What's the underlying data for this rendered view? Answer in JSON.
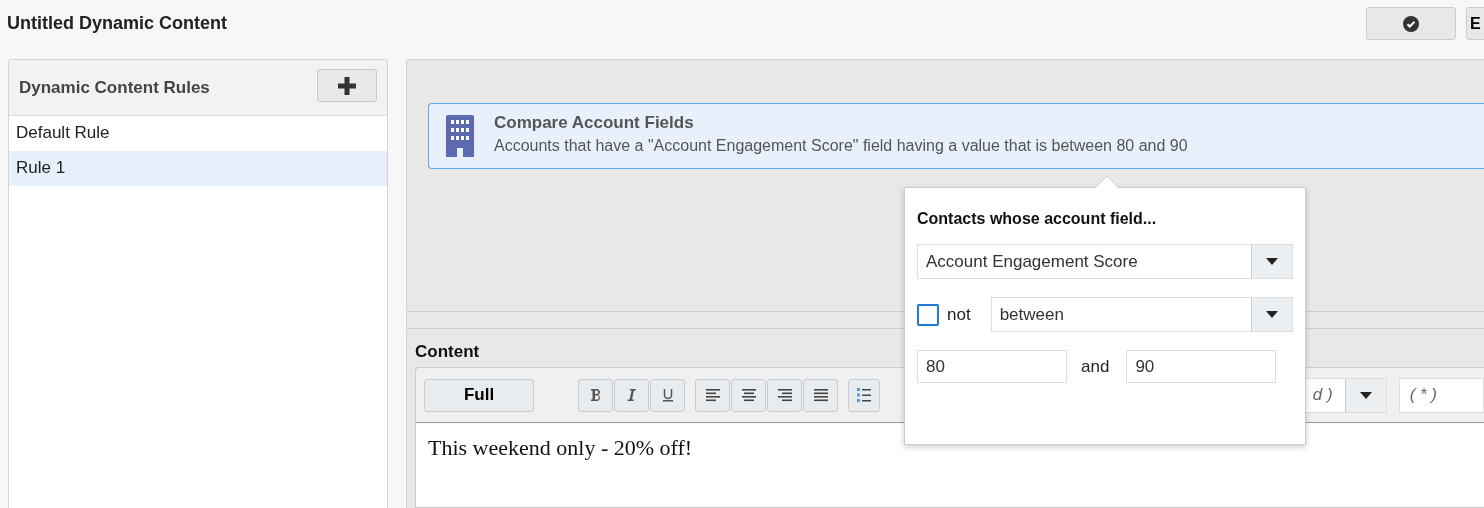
{
  "header": {
    "title": "Untitled Dynamic Content",
    "buttons": [
      {
        "kind": "icon"
      },
      {
        "kind": "text",
        "label": "E"
      }
    ]
  },
  "rules_panel": {
    "title": "Dynamic Content Rules",
    "items": [
      {
        "label": "Default Rule",
        "selected": false
      },
      {
        "label": "Rule 1",
        "selected": true
      }
    ]
  },
  "condition": {
    "title": "Compare Account Fields",
    "description": "Accounts that have a \"Account Engagement Score\" field having a value that is between 80 and 90"
  },
  "popover": {
    "title": "Contacts whose account field...",
    "field": "Account Engagement Score",
    "not_label": "not",
    "not_checked": false,
    "operator": "between",
    "value_from": "80",
    "and_label": "and",
    "value_to": "90"
  },
  "content": {
    "label": "Content",
    "mode_button": "Full",
    "dropdown_value": "d )",
    "field_value": "( * )",
    "text": "This weekend only - 20% off!"
  }
}
